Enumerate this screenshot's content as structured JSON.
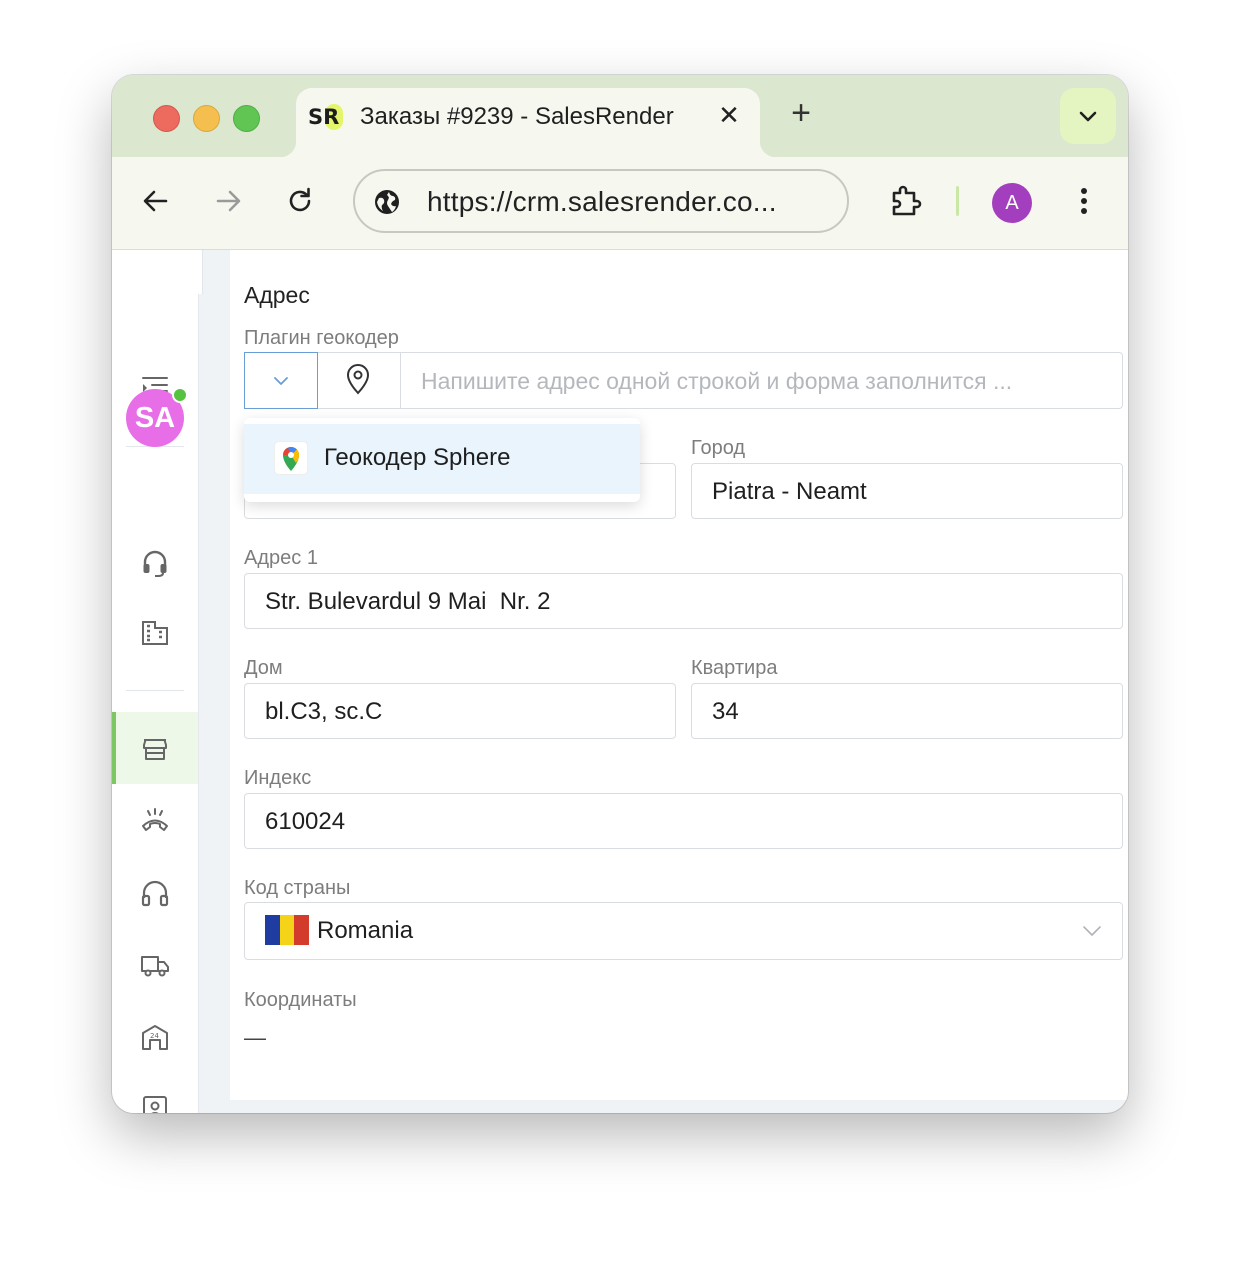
{
  "browser": {
    "tab_favicon_text": "SR",
    "tab_title": "Заказы #9239 - SalesRender",
    "tab_close": "✕",
    "new_tab": "+",
    "url": "https://crm.salesrender.co...",
    "profile_initial": "A"
  },
  "sidebar": {
    "user_initials": "SA",
    "online_color": "#55c340",
    "items": [
      "menu-toggle-icon",
      "headset-icon",
      "building-icon",
      "store-icon",
      "call-end-icon",
      "headphones-icon",
      "truck-icon",
      "warehouse-icon",
      "contact-card-icon",
      "history-icon"
    ],
    "active_item": "store-icon"
  },
  "form": {
    "section_title": "Адрес",
    "geocoder_label": "Плагин геокодер",
    "geocoder_placeholder": "Напишите адрес одной строкой и форма заполнится ...",
    "geocoder_option": "Геокодер Sphere",
    "city_label": "Город",
    "city_value": "Piatra - Neamt",
    "address1_label": "Адрес 1",
    "address1_value": "Str. Bulevardul 9 Mai  Nr. 2",
    "house_label": "Дом",
    "house_value": "bl.C3, sc.C",
    "apartment_label": "Квартира",
    "apartment_value": "34",
    "index_label": "Индекс",
    "index_value": "610024",
    "country_label": "Код страны",
    "country_value": "Romania",
    "coordinates_label": "Координаты",
    "coordinates_value": "—"
  },
  "colors": {
    "accent_green": "#7cc762",
    "dropdown_border": "#6a9ed8",
    "flag": [
      "#1f3da0",
      "#f5d318",
      "#d33b2c"
    ]
  }
}
